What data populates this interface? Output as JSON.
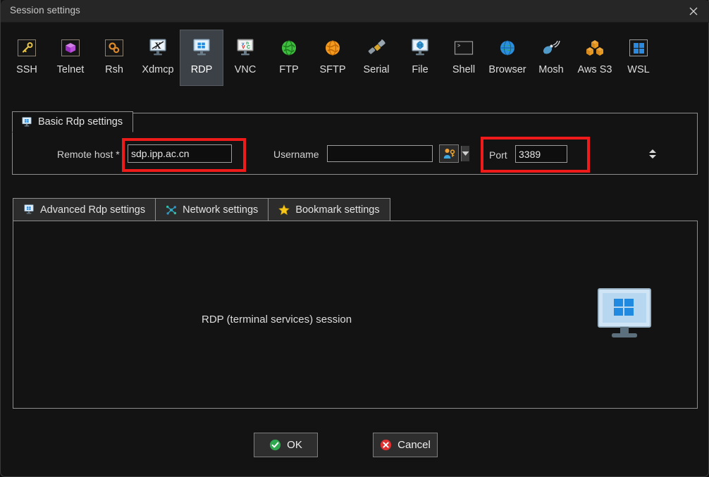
{
  "window": {
    "title": "Session settings",
    "close_icon": "close-icon"
  },
  "toolbar": {
    "items": [
      {
        "label": "SSH",
        "icon": "key-icon"
      },
      {
        "label": "Telnet",
        "icon": "purple-cube-icon"
      },
      {
        "label": "Rsh",
        "icon": "gears-icon"
      },
      {
        "label": "Xdmcp",
        "icon": "x-monitor-icon"
      },
      {
        "label": "RDP",
        "icon": "windows-monitor-icon"
      },
      {
        "label": "VNC",
        "icon": "vnc-monitor-icon"
      },
      {
        "label": "FTP",
        "icon": "green-globe-icon"
      },
      {
        "label": "SFTP",
        "icon": "orange-globe-icon"
      },
      {
        "label": "Serial",
        "icon": "serial-plug-icon"
      },
      {
        "label": "File",
        "icon": "file-globe-monitor-icon"
      },
      {
        "label": "Shell",
        "icon": "terminal-prompt-icon"
      },
      {
        "label": "Browser",
        "icon": "blue-globe-icon"
      },
      {
        "label": "Mosh",
        "icon": "satellite-dish-icon"
      },
      {
        "label": "Aws S3",
        "icon": "aws-cubes-icon"
      },
      {
        "label": "WSL",
        "icon": "windows-square-icon"
      }
    ],
    "selected": "RDP"
  },
  "basic_group": {
    "tab_label": "Basic Rdp settings",
    "tab_icon": "windows-monitor-icon",
    "remote_host_label": "Remote host *",
    "remote_host_value": "sdp.ipp.ac.cn",
    "username_label": "Username",
    "username_value": "",
    "username_dropdown_icon": "chevron-down-icon",
    "user_key_icon": "user-key-icon",
    "port_label": "Port",
    "port_value": "3389",
    "port_spinner_icon": "spinner-arrows-icon"
  },
  "annotations": {
    "highlight_color": "#ef1b1b",
    "boxes": [
      "remote-host-highlight",
      "port-highlight"
    ]
  },
  "sub_tabs": [
    {
      "label": "Advanced Rdp settings",
      "icon": "windows-monitor-icon"
    },
    {
      "label": "Network settings",
      "icon": "network-star-icon"
    },
    {
      "label": "Bookmark settings",
      "icon": "star-icon"
    }
  ],
  "content": {
    "description": "RDP (terminal services) session",
    "illustration_icon": "windows-monitor-large-icon"
  },
  "footer": {
    "ok_label": "OK",
    "ok_icon": "green-check-icon",
    "cancel_label": "Cancel",
    "cancel_icon": "red-x-icon"
  }
}
